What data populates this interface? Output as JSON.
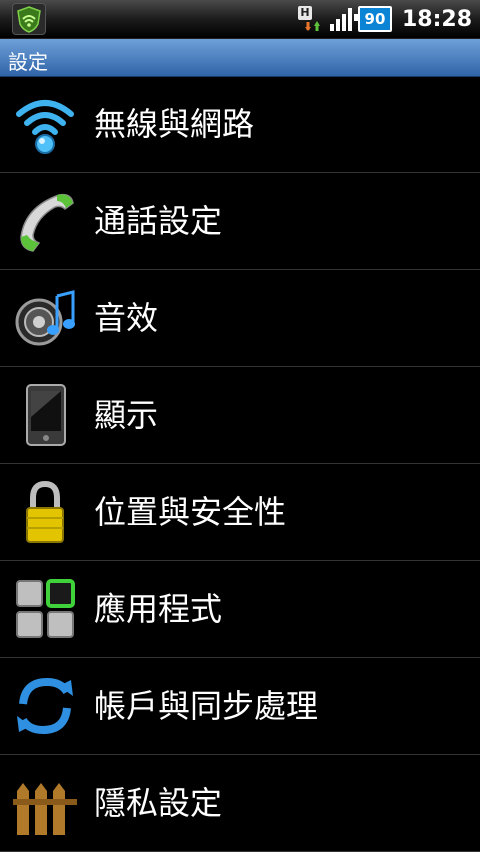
{
  "status_bar": {
    "network_type": "H",
    "battery_level": "90",
    "time": "18:28"
  },
  "title_bar": {
    "title": "設定"
  },
  "settings": {
    "items": [
      {
        "label": "無線與網路",
        "icon": "wifi-icon"
      },
      {
        "label": "通話設定",
        "icon": "phone-handset-icon"
      },
      {
        "label": "音效",
        "icon": "speaker-music-icon"
      },
      {
        "label": "顯示",
        "icon": "display-phone-icon"
      },
      {
        "label": "位置與安全性",
        "icon": "padlock-icon"
      },
      {
        "label": "應用程式",
        "icon": "apps-grid-icon"
      },
      {
        "label": "帳戶與同步處理",
        "icon": "sync-arrows-icon"
      },
      {
        "label": "隱私設定",
        "icon": "fence-icon"
      }
    ]
  },
  "colors": {
    "title_bar": "#3f76b9",
    "background": "#000000",
    "battery": "#0b84d6"
  }
}
